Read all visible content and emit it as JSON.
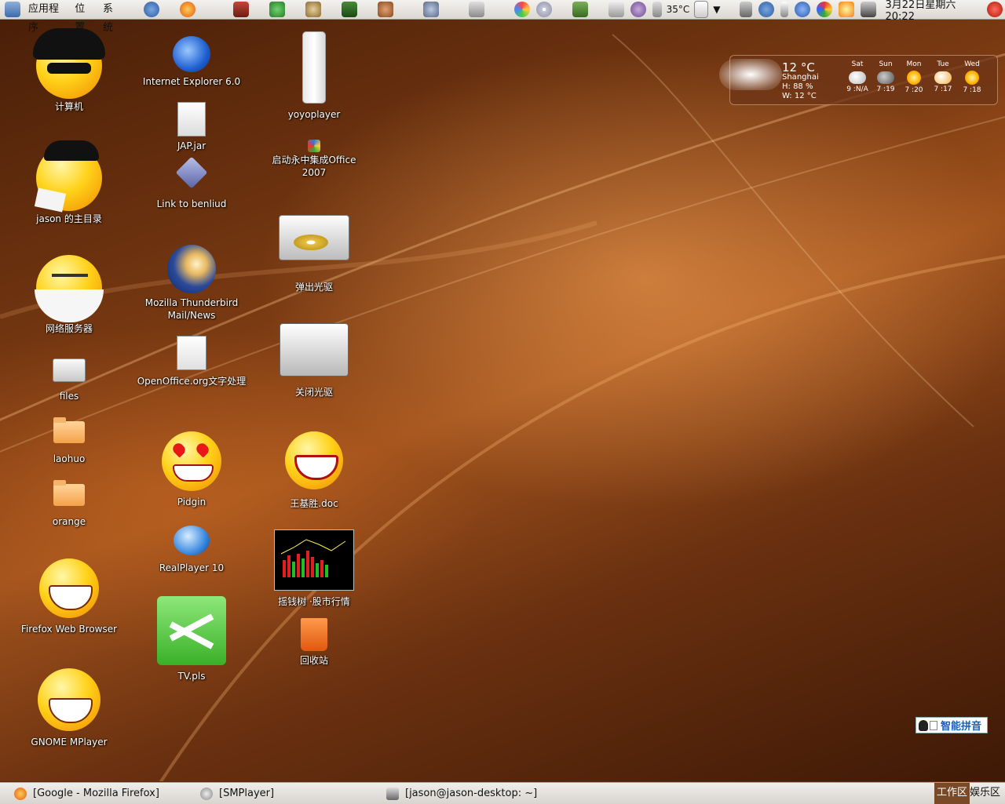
{
  "top_panel": {
    "menus": [
      "应用程序",
      "位置",
      "系统"
    ],
    "tray": {
      "temperature": "35°C",
      "clock": "3月22日星期六 20:22"
    }
  },
  "desktop": {
    "icons": [
      {
        "label": "计算机",
        "icon": "computer-smiley-icon"
      },
      {
        "label": "jason 的主目录",
        "icon": "home-smiley-icon"
      },
      {
        "label": "网络服务器",
        "icon": "network-smiley-icon"
      },
      {
        "label": "files",
        "icon": "drive-icon"
      },
      {
        "label": "laohuo",
        "icon": "folder-icon"
      },
      {
        "label": "orange",
        "icon": "folder-icon"
      },
      {
        "label": "Firefox Web Browser",
        "icon": "grin-smiley-icon"
      },
      {
        "label": "GNOME MPlayer",
        "icon": "wink-smiley-icon"
      },
      {
        "label": "Internet Explorer 6.0",
        "icon": "ie-icon"
      },
      {
        "label": "JAP.jar",
        "icon": "file-icon"
      },
      {
        "label": "Link to benliud",
        "icon": "link-icon"
      },
      {
        "label": "Mozilla Thunderbird Mail/News",
        "icon": "thunderbird-icon"
      },
      {
        "label": "OpenOffice.org文字处理",
        "icon": "writer-icon"
      },
      {
        "label": "Pidgin",
        "icon": "love-smiley-icon"
      },
      {
        "label": "RealPlayer 10",
        "icon": "realplayer-icon"
      },
      {
        "label": "TV.pls",
        "icon": "shuffle-icon"
      },
      {
        "label": "yoyoplayer",
        "icon": "ipod-icon"
      },
      {
        "label": "启动永中集成Office 2007",
        "icon": "office-icon"
      },
      {
        "label": "弹出光驱",
        "icon": "cdrom-open-icon"
      },
      {
        "label": "关闭光驱",
        "icon": "cdrom-closed-icon"
      },
      {
        "label": "王基胜.doc",
        "icon": "laugh-smiley-icon"
      },
      {
        "label": "摇钱树 ·股市行情",
        "icon": "stock-chart-icon"
      },
      {
        "label": "回收站",
        "icon": "trash-icon"
      }
    ]
  },
  "weather": {
    "temp": "12 °C",
    "city": "Shanghai",
    "humidity": "H: 88 %",
    "wind": "W: 12 °C",
    "days": [
      {
        "day": "Sat",
        "low": "9 :",
        "high": "N/A",
        "icon": "partly-cloudy-icon"
      },
      {
        "day": "Sun",
        "low": "7 :",
        "high": "19",
        "icon": "cloudy-icon"
      },
      {
        "day": "Mon",
        "low": "7 :",
        "high": "20",
        "icon": "sunny-icon"
      },
      {
        "day": "Tue",
        "low": "7 :",
        "high": "17",
        "icon": "partly-cloudy-icon"
      },
      {
        "day": "Wed",
        "low": "7 :",
        "high": "18",
        "icon": "sunny-icon"
      }
    ]
  },
  "ime": {
    "label": "智能拼音"
  },
  "taskbar": {
    "tasks": [
      "[Google - Mozilla Firefox]",
      "[SMPlayer]",
      "[jason@jason-desktop: ~]"
    ],
    "workspaces": [
      "工作区",
      "娱乐区"
    ]
  },
  "colors": {
    "wallpaper_dark": "#4a1f08",
    "wallpaper_light": "#a0521c",
    "panel": "#e8e5e0",
    "ime_text": "#1b5fb5",
    "active_workspace": "#7a4a28"
  }
}
